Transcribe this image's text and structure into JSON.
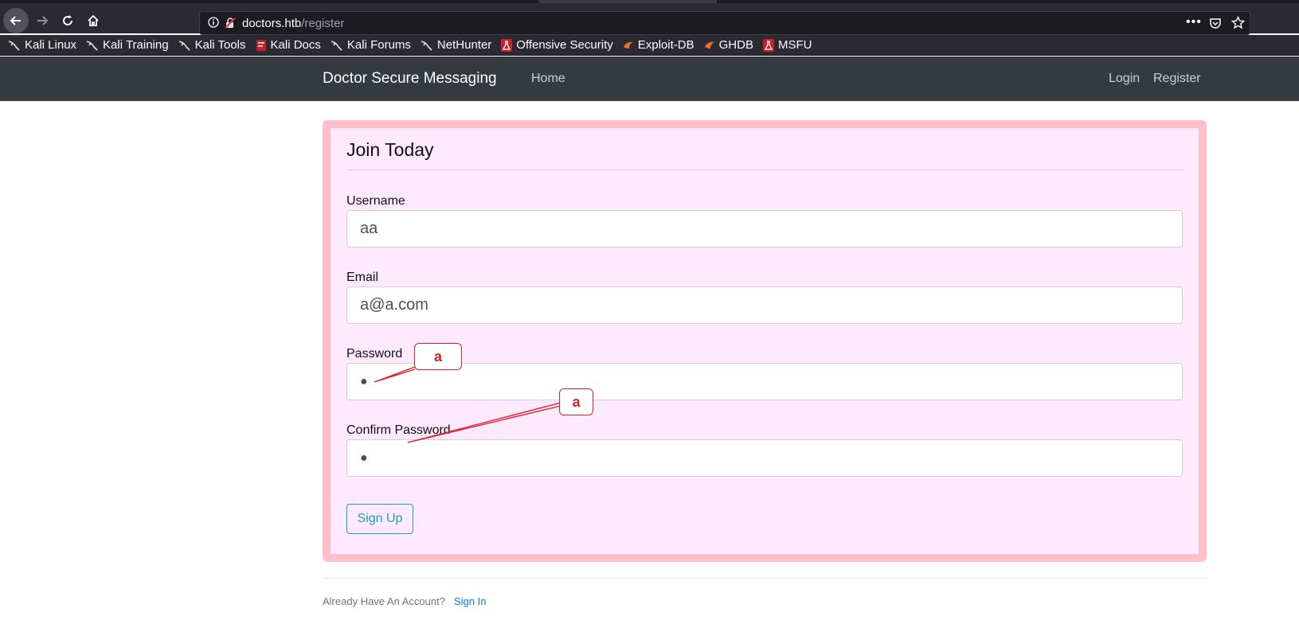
{
  "browser": {
    "url_host": "doctors.htb",
    "url_path": "/register",
    "more_label": "•••",
    "bookmarks": [
      {
        "label": "Kali Linux",
        "icon": "kali-dragon-icon"
      },
      {
        "label": "Kali Training",
        "icon": "kali-dragon-icon"
      },
      {
        "label": "Kali Tools",
        "icon": "kali-dragon-icon"
      },
      {
        "label": "Kali Docs",
        "icon": "kali-docs-icon"
      },
      {
        "label": "Kali Forums",
        "icon": "kali-dragon-icon"
      },
      {
        "label": "NetHunter",
        "icon": "kali-dragon-icon"
      },
      {
        "label": "Offensive Security",
        "icon": "offsec-icon"
      },
      {
        "label": "Exploit-DB",
        "icon": "exploitdb-icon"
      },
      {
        "label": "GHDB",
        "icon": "exploitdb-icon"
      },
      {
        "label": "MSFU",
        "icon": "offsec-icon"
      }
    ]
  },
  "site_nav": {
    "brand": "Doctor Secure Messaging",
    "home": "Home",
    "login": "Login",
    "register": "Register"
  },
  "form": {
    "legend": "Join Today",
    "username_label": "Username",
    "username_value": "aa",
    "email_label": "Email",
    "email_value": "a@a.com",
    "password_label": "Password",
    "password_value": "●",
    "confirm_label": "Confirm Password",
    "confirm_value": "●",
    "submit_label": "Sign Up"
  },
  "annotations": {
    "password_callout": "a",
    "confirm_callout": "a",
    "color": "#e0202a"
  },
  "footer": {
    "text": "Already Have An Account?",
    "link": "Sign In"
  },
  "colors": {
    "nav_bg": "#343a40",
    "card_border": "#ffc0cb",
    "card_bg": "#ffe9ff",
    "button_accent": "#17a2b8",
    "link": "#007bff"
  }
}
